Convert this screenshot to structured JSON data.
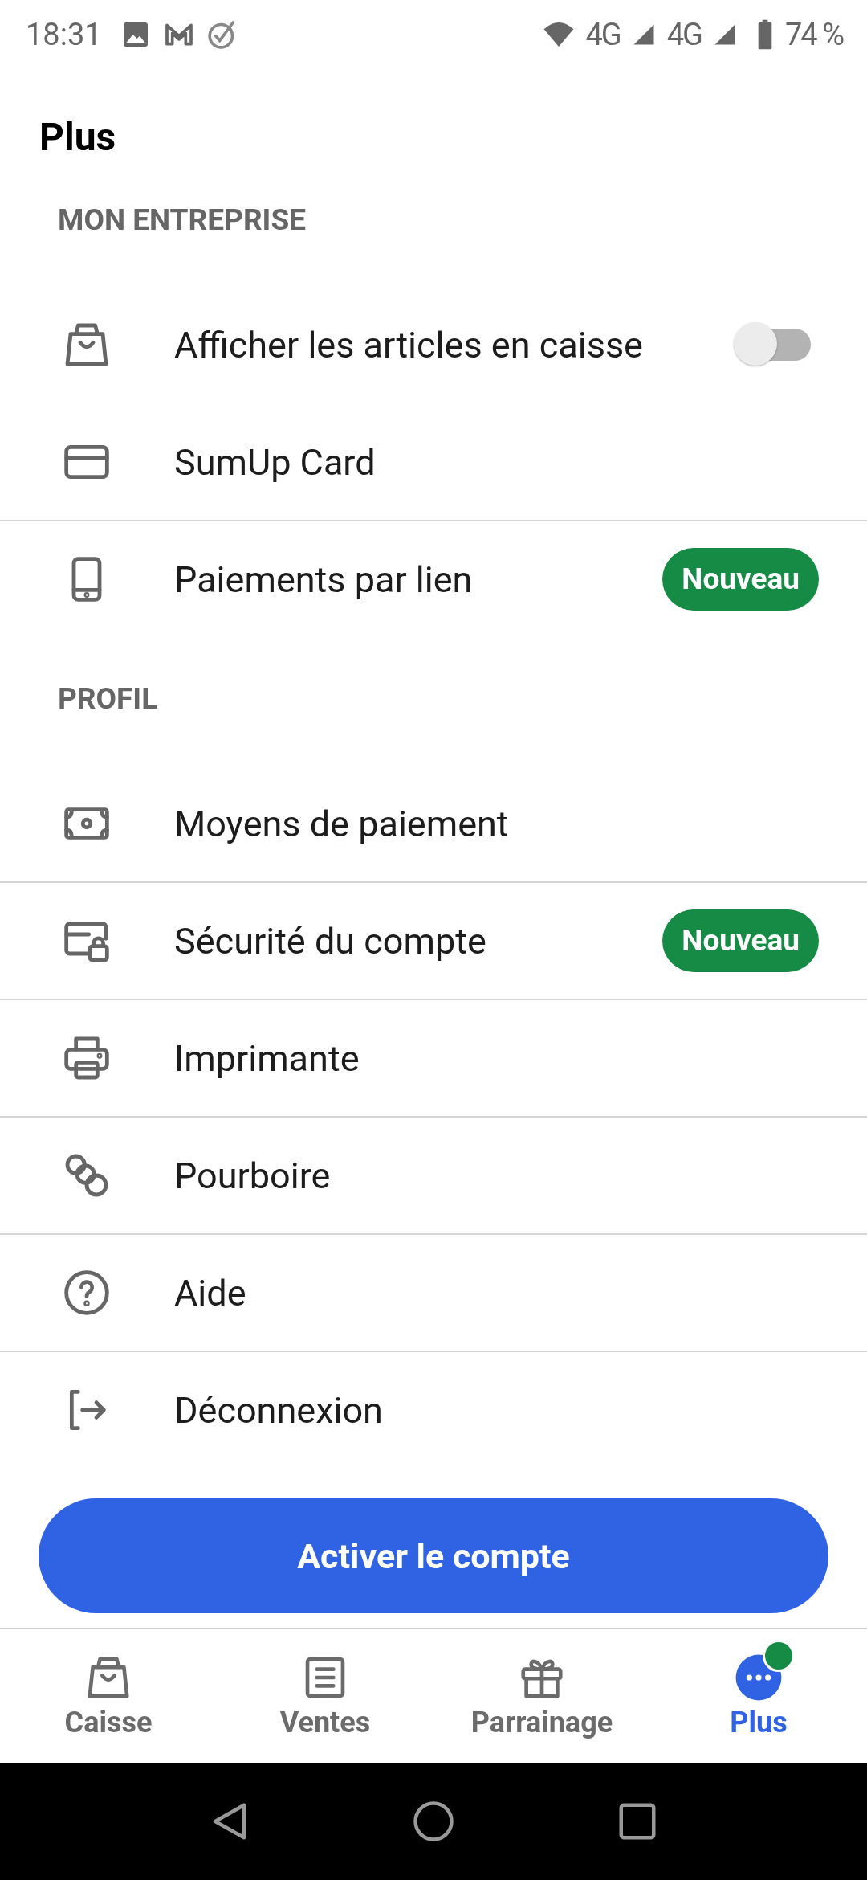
{
  "status_bar": {
    "time": "18:31",
    "network_1": "4G",
    "network_2": "4G",
    "battery": "74 %"
  },
  "title": "Plus",
  "sections": [
    {
      "header": "MON ENTREPRISE",
      "items": [
        {
          "label": "Afficher les articles en caisse",
          "kind": "toggle",
          "on": false,
          "divider_below": false
        },
        {
          "label": "SumUp Card",
          "kind": "plain",
          "divider_below": true
        },
        {
          "label": "Paiements par lien",
          "kind": "badge",
          "badge": "Nouveau",
          "divider_below": false
        }
      ]
    },
    {
      "header": "PROFIL",
      "items": [
        {
          "label": "Moyens de paiement",
          "kind": "plain",
          "divider_below": true
        },
        {
          "label": "Sécurité du compte",
          "kind": "badge",
          "badge": "Nouveau",
          "divider_below": true
        },
        {
          "label": "Imprimante",
          "kind": "plain",
          "divider_below": true
        },
        {
          "label": "Pourboire",
          "kind": "plain",
          "divider_below": true
        },
        {
          "label": "Aide",
          "kind": "plain",
          "divider_below": true
        },
        {
          "label": "Déconnexion",
          "kind": "plain",
          "divider_below": false
        }
      ]
    }
  ],
  "primary_button": "Activer le compte",
  "nav": [
    {
      "label": "Caisse",
      "selected": false,
      "dot": false
    },
    {
      "label": "Ventes",
      "selected": false,
      "dot": false
    },
    {
      "label": "Parrainage",
      "selected": false,
      "dot": false
    },
    {
      "label": "Plus",
      "selected": true,
      "dot": true
    }
  ]
}
